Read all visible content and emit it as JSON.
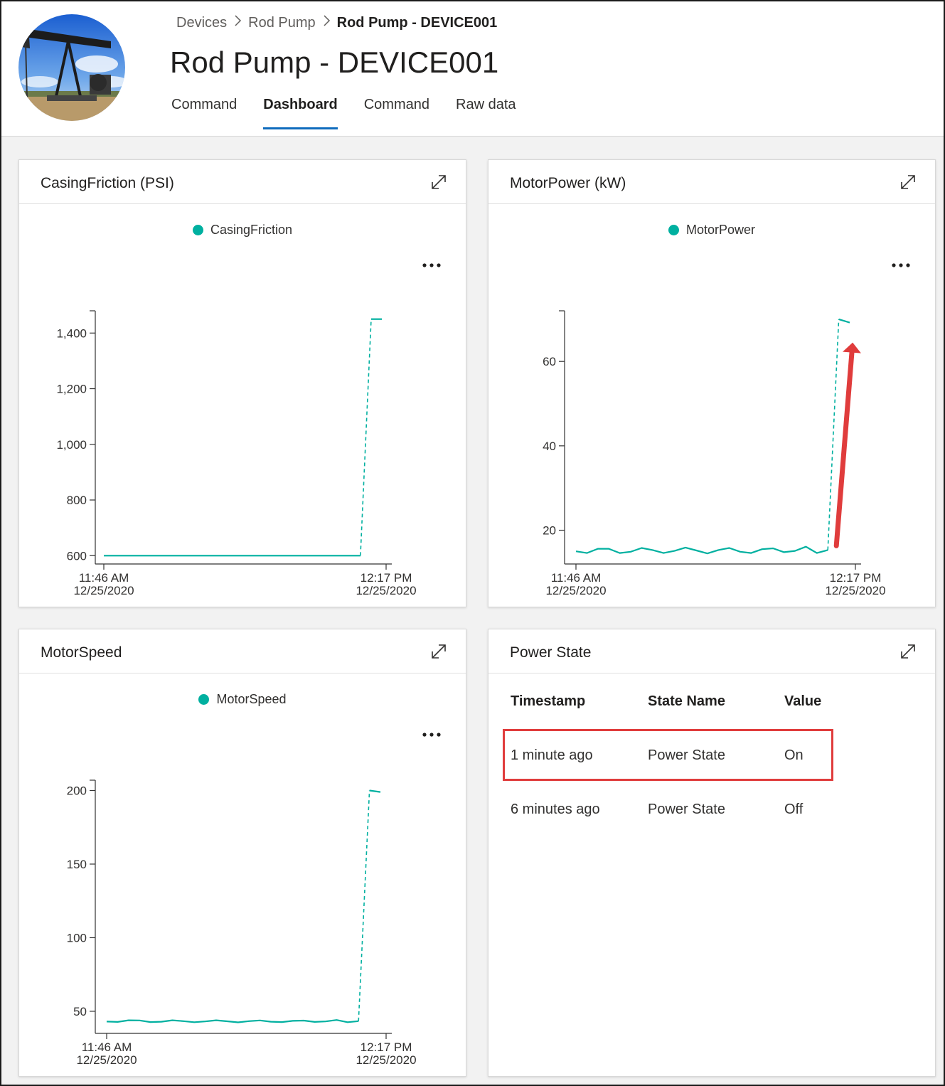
{
  "breadcrumb": {
    "items": [
      "Devices",
      "Rod Pump",
      "Rod Pump - DEVICE001"
    ],
    "separator": ">"
  },
  "page_title": "Rod Pump - DEVICE001",
  "tabs": [
    {
      "label": "Command",
      "active": false
    },
    {
      "label": "Dashboard",
      "active": true
    },
    {
      "label": "Command",
      "active": false
    },
    {
      "label": "Raw data",
      "active": false
    }
  ],
  "colors": {
    "series": "#00b0a0",
    "accent": "#0f6cbd",
    "highlight": "#e03c3c"
  },
  "icons": {
    "expand": "expand-icon",
    "more": "more-options-icon",
    "avatar": "oil-pumpjack-photo"
  },
  "cards": {
    "casing": {
      "title": "CasingFriction (PSI)",
      "legend": "CasingFriction"
    },
    "motorpower": {
      "title": "MotorPower (kW)",
      "legend": "MotorPower"
    },
    "motorspeed": {
      "title": "MotorSpeed",
      "legend": "MotorSpeed"
    },
    "powerstate": {
      "title": "Power State",
      "columns": [
        "Timestamp",
        "State Name",
        "Value"
      ],
      "rows": [
        {
          "timestamp": "1 minute ago",
          "state_name": "Power State",
          "value": "On",
          "highlighted": true
        },
        {
          "timestamp": "6 minutes ago",
          "state_name": "Power State",
          "value": "Off",
          "highlighted": false
        }
      ]
    }
  },
  "chart_data": [
    {
      "type": "line",
      "title": "CasingFriction (PSI)",
      "series": [
        {
          "name": "CasingFriction",
          "values": [
            600,
            600,
            600,
            600,
            600,
            600,
            600,
            600,
            600,
            600,
            600,
            600,
            600,
            600,
            600,
            600,
            600,
            600,
            600,
            600,
            600,
            600,
            600,
            600,
            600,
            1450,
            1450
          ],
          "dashed_from_index": 24
        }
      ],
      "x_tick_labels": [
        [
          "11:46 AM",
          "12/25/2020"
        ],
        [
          "12:17 PM",
          "12/25/2020"
        ]
      ],
      "yticks": [
        600,
        800,
        1000,
        1200,
        1400
      ],
      "y_tick_labels": [
        "600",
        "800",
        "1,000",
        "1,200",
        "1,400"
      ],
      "ylim": [
        570,
        1480
      ],
      "legend": "top-center"
    },
    {
      "type": "line",
      "title": "MotorPower (kW)",
      "series": [
        {
          "name": "MotorPower",
          "values": [
            15,
            14.6,
            15.6,
            15.6,
            14.6,
            14.9,
            15.8,
            15.3,
            14.6,
            15.1,
            15.9,
            15.2,
            14.5,
            15.3,
            15.8,
            14.9,
            14.6,
            15.5,
            15.7,
            14.8,
            15.1,
            16.1,
            14.6,
            15.3,
            70,
            69.2
          ],
          "dashed_from_index": 23
        }
      ],
      "x_tick_labels": [
        [
          "11:46 AM",
          "12/25/2020"
        ],
        [
          "12:17 PM",
          "12/25/2020"
        ]
      ],
      "yticks": [
        20,
        40,
        60
      ],
      "y_tick_labels": [
        "20",
        "40",
        "60"
      ],
      "ylim": [
        12,
        72
      ],
      "legend": "top-center",
      "annotation": "red arrow pointing up toward the latest value"
    },
    {
      "type": "line",
      "title": "MotorSpeed",
      "series": [
        {
          "name": "MotorSpeed",
          "values": [
            43,
            42.8,
            43.9,
            43.8,
            42.7,
            42.9,
            43.9,
            43.3,
            42.6,
            43.1,
            43.9,
            43.2,
            42.5,
            43.3,
            43.8,
            42.9,
            42.7,
            43.5,
            43.7,
            42.8,
            43.1,
            44.1,
            42.6,
            43.3,
            200,
            199
          ],
          "dashed_from_index": 23
        }
      ],
      "x_tick_labels": [
        [
          "11:46 AM",
          "12/25/2020"
        ],
        [
          "12:17 PM",
          "12/25/2020"
        ]
      ],
      "yticks": [
        50,
        100,
        150,
        200
      ],
      "y_tick_labels": [
        "50",
        "100",
        "150",
        "200"
      ],
      "ylim": [
        35,
        207
      ],
      "legend": "top-center"
    }
  ]
}
